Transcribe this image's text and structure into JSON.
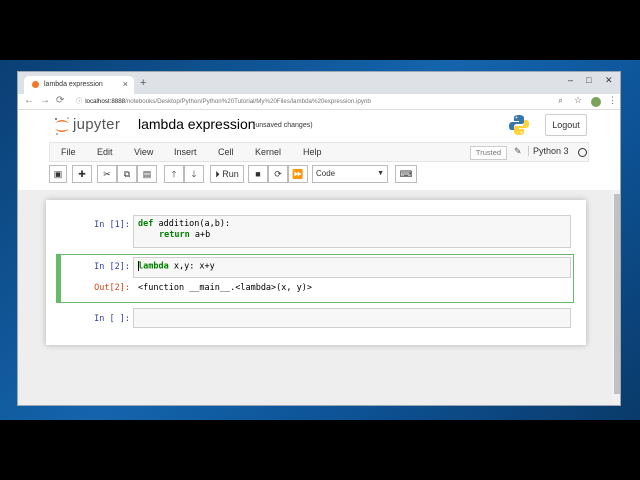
{
  "browser": {
    "tab_title": "lambda expression",
    "tab_close": "×",
    "new_tab": "+",
    "url_host": "localhost:8888",
    "url_path": "/notebooks/Desktop/Python/Python%20Tutorial/My%20Files/lambda%20expression.ipynb",
    "window_controls": [
      "–",
      "□",
      "✕"
    ],
    "nav": [
      "←",
      "→",
      "⟳"
    ]
  },
  "header": {
    "brand": "jupyter",
    "notebook_title": "lambda expression",
    "save_status": "(unsaved changes)",
    "logout_label": "Logout"
  },
  "menubar": {
    "items": [
      "File",
      "Edit",
      "View",
      "Insert",
      "Cell",
      "Kernel",
      "Help"
    ],
    "trusted_label": "Trusted",
    "kernel_name": "Python 3"
  },
  "toolbar": {
    "run_label": "Run",
    "cell_type": "Code",
    "icons": [
      "save-icon",
      "add-cell-icon",
      "cut-icon",
      "copy-icon",
      "paste-icon",
      "move-up-icon",
      "move-down-icon",
      "run-icon",
      "stop-icon",
      "restart-icon",
      "fast-forward-icon",
      "keyboard-icon"
    ]
  },
  "cells": [
    {
      "prompt": "In [1]:",
      "code_line1_kw": "def",
      "code_line1_rest": " addition(a,b):",
      "code_line2_kw": "return",
      "code_line2_rest": " a+b"
    },
    {
      "prompt": "In [2]:",
      "code_kw": "lambda",
      "code_rest": " x,y: x+y",
      "out_prompt": "Out[2]:",
      "output": "<function __main__.<lambda>(x, y)>"
    },
    {
      "prompt": "In [ ]:"
    }
  ]
}
